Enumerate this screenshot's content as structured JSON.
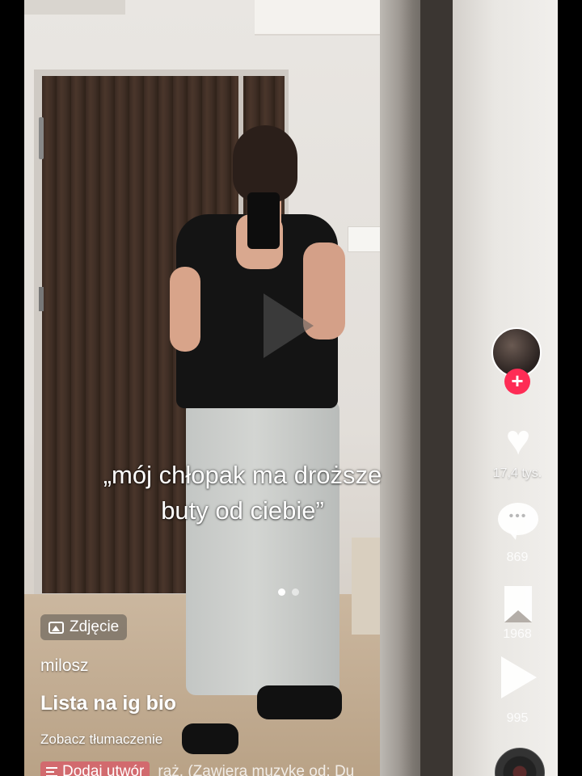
{
  "video": {
    "caption": "„mój chłopak ma droższe\nbuty od ciebie”",
    "carousel": {
      "count": 2,
      "active_index": 0
    }
  },
  "info": {
    "photo_badge": "Zdjęcie",
    "username": "milosz",
    "description": "Lista na ig bio",
    "translate_link": "Zobacz tłumaczenie",
    "add_song_label": "Dodaj utwór",
    "music_text": "raż. (Zawiera muzykę od: Du"
  },
  "rail": {
    "likes": "17,4 tys.",
    "comments": "869",
    "bookmarks": "1968",
    "shares": "995"
  },
  "icons": [
    "play-icon",
    "image-icon",
    "heart-icon",
    "comment-icon",
    "bookmark-icon",
    "share-icon",
    "plus-icon",
    "music-disc-icon"
  ],
  "colors": {
    "follow_accent": "#fe2c55"
  }
}
